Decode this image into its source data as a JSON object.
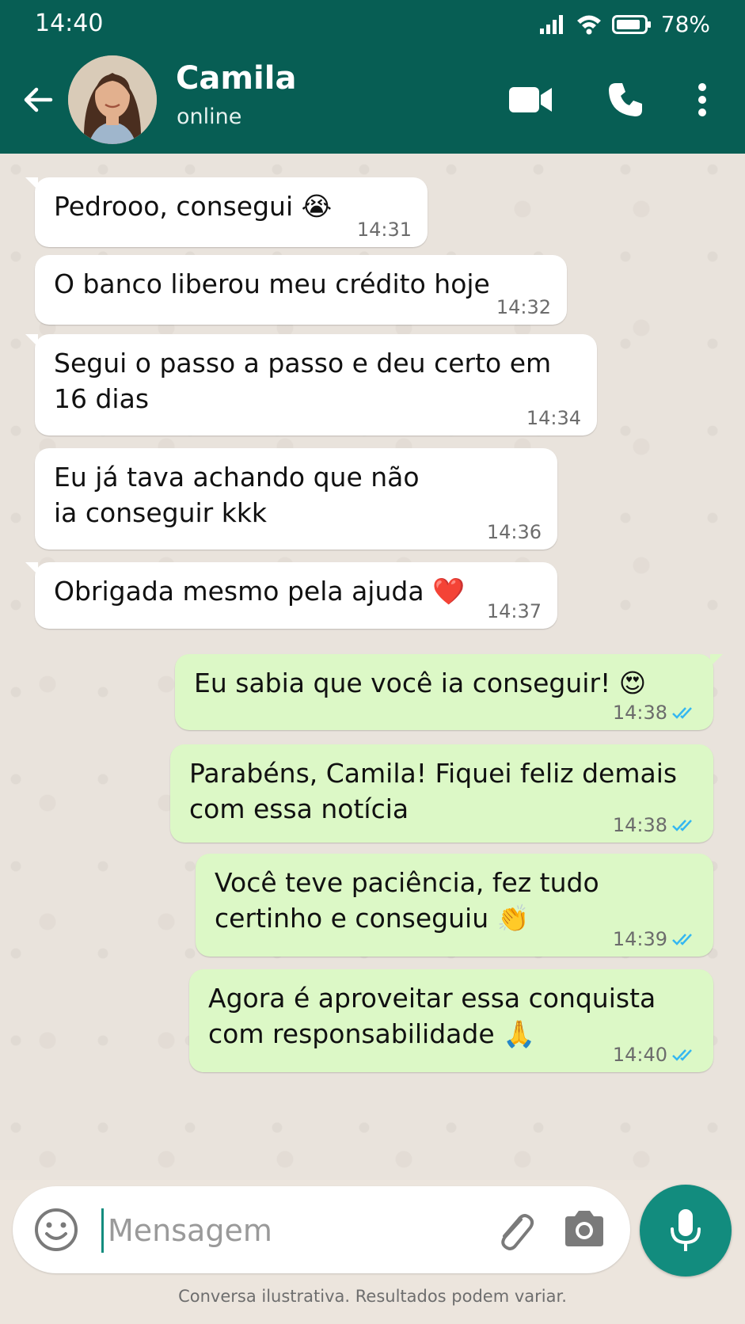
{
  "status_bar": {
    "time": "14:40",
    "battery": "78%"
  },
  "header": {
    "contact_name": "Camila",
    "contact_status": "online",
    "icons": [
      "back-arrow-icon",
      "video-call-icon",
      "phone-icon",
      "more-vert-icon"
    ]
  },
  "messages": [
    {
      "dir": "in",
      "text": "Pedrooo, consegui 😭",
      "time": "14:31"
    },
    {
      "dir": "in",
      "text": "O banco liberou meu crédito hoje",
      "time": "14:32"
    },
    {
      "dir": "in",
      "text": "Segui o passo a passo e deu certo em 16 dias",
      "time": "14:34"
    },
    {
      "dir": "in",
      "text": "Eu já tava achando que não ia conseguir kkk",
      "time": "14:36"
    },
    {
      "dir": "in",
      "text": "Obrigada mesmo pela ajuda ❤️",
      "time": "14:37"
    },
    {
      "dir": "out",
      "text": "Eu sabia que você ia conseguir! 😍",
      "time": "14:38",
      "read": true
    },
    {
      "dir": "out",
      "text": "Parabéns, Camila! Fiquei feliz demais com essa notícia",
      "time": "14:38",
      "read": true
    },
    {
      "dir": "out",
      "text": "Você teve paciência, fez tudo certinho e conseguiu 👏",
      "time": "14:39",
      "read": true
    },
    {
      "dir": "out",
      "text": "Agora é aproveitar essa conquista com responsabilidade 🙏",
      "time": "14:40",
      "read": true
    }
  ],
  "composer": {
    "placeholder": "Mensagem"
  },
  "footer": {
    "disclaimer": "Conversa ilustrativa. Resultados podem variar."
  },
  "colors": {
    "header": "#075e54",
    "accent": "#128c7e",
    "outgoing_bubble": "#dcf8c6",
    "read_ticks": "#34b7f1"
  }
}
